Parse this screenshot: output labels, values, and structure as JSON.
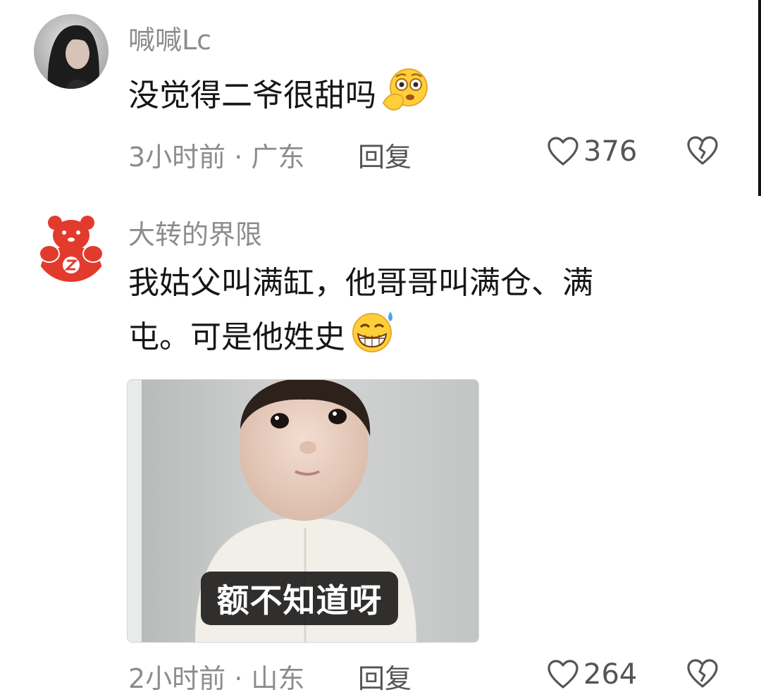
{
  "comments": [
    {
      "username": "喊喊Lc",
      "text": "没觉得二爷很甜吗",
      "emoji_icon": "worried-face-emoji",
      "meta": "3小时前 · 广东",
      "reply_label": "回复",
      "likes": "376"
    },
    {
      "username": "大转的界限",
      "text_line1": "我姑父叫满缸，他哥哥叫满仓、满",
      "text_line2": "屯。可是他姓史",
      "emoji_icon": "grin-sweat-emoji",
      "media_caption": "额不知道呀",
      "meta": "2小时前 · 山东",
      "reply_label": "回复",
      "likes": "264"
    }
  ],
  "colors": {
    "meta_gray": "#8c8c8c",
    "text": "#161616",
    "avatar_red": "#e23b2e"
  }
}
